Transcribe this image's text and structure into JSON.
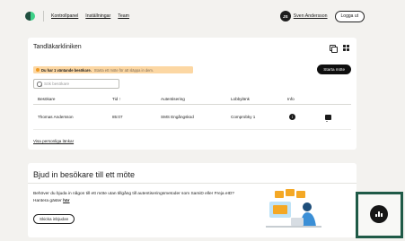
{
  "header": {
    "nav": [
      "Kontrollpanel",
      "Inställningar",
      "Team"
    ],
    "user_initials": "JS",
    "user_name": "Sven Andersson",
    "logout_label": "Logga ut"
  },
  "clinic_card": {
    "title": "Tandläkarkliniken",
    "banner_bold": "Du har 1 väntande besökare.",
    "banner_text": "Starta ett möte för att släppa in dem.",
    "start_meeting_label": "Starta möte",
    "search_placeholder": "Sök besökare",
    "columns": [
      "Besökare",
      "Tid ↑",
      "Autentisering",
      "Lobbylänk",
      "Info"
    ],
    "rows": [
      {
        "visitor": "Thomas Andersson",
        "time": "85:07",
        "auth": "SMS Engångskod",
        "lobby": "Comprobky 1",
        "info": "i"
      }
    ],
    "personal_links_label": "Visa personliga länkar"
  },
  "invite_card": {
    "title": "Bjud in besökare till ett möte",
    "body": "Behöver du bjuda in någon till ett möte utan tillgång till autentiseringsmetoder som SamiD eller Freja eID? Hantera gäster",
    "body_link": "här",
    "send_invite_label": "Skicka inbjudan"
  },
  "colors": {
    "brand_dark": "#1f4f3f",
    "brand_green": "#3ed188",
    "banner_bg": "#fcd7a3",
    "frame": "#1f5a47"
  },
  "icons": [
    "copy-icon",
    "qr-code-icon",
    "search-icon",
    "info-icon",
    "chat-icon",
    "chart-icon"
  ]
}
